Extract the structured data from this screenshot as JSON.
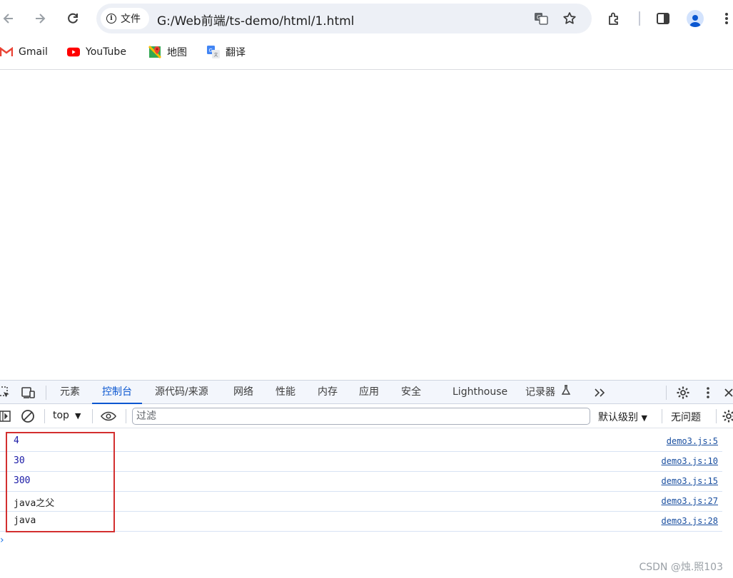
{
  "toolbar": {
    "site_chip_label": "文件",
    "url": "G:/Web前端/ts-demo/html/1.html"
  },
  "bookmarks": [
    {
      "label": "Gmail",
      "icon": "gmail-icon"
    },
    {
      "label": "YouTube",
      "icon": "youtube-icon"
    },
    {
      "label": "地图",
      "icon": "maps-icon"
    },
    {
      "label": "翻译",
      "icon": "translate-icon"
    }
  ],
  "devtools": {
    "tabs": [
      "元素",
      "控制台",
      "源代码/来源",
      "网络",
      "性能",
      "内存",
      "应用",
      "安全",
      "Lighthouse",
      "记录器"
    ],
    "active_tab": "控制台",
    "context": "top",
    "filter_placeholder": "过滤",
    "levels_label": "默认级别",
    "issues_label": "无问题"
  },
  "console": {
    "rows": [
      {
        "text": "4",
        "source": "demo3.js:5",
        "kind": "number"
      },
      {
        "text": "30",
        "source": "demo3.js:10",
        "kind": "number"
      },
      {
        "text": "300",
        "source": "demo3.js:15",
        "kind": "number"
      },
      {
        "text": "java之父",
        "source": "demo3.js:27",
        "kind": "string"
      },
      {
        "text": "java",
        "source": "demo3.js:28",
        "kind": "string"
      }
    ],
    "prompt": "›"
  },
  "watermark": "CSDN @烛.照103",
  "colors": {
    "accent": "#0b57d0",
    "number_text": "#1a1aa6",
    "highlight_box": "#d32f2f"
  }
}
